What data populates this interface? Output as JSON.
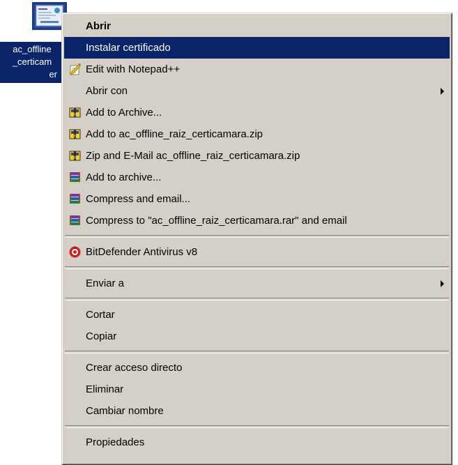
{
  "desktop_file": {
    "label_lines": [
      "ac_offline",
      "_certicam",
      "er"
    ],
    "icon": "certificate-icon"
  },
  "menu": {
    "items": [
      {
        "label": "Abrir",
        "icon": null
      },
      {
        "label": "Instalar certificado",
        "icon": null
      },
      {
        "label": "Edit with Notepad++",
        "icon": "notepad-plus-plus-icon"
      },
      {
        "label": "Abrir con",
        "icon": null
      },
      {
        "label": "Add to Archive...",
        "icon": "winzip-icon"
      },
      {
        "label": "Add to ac_offline_raiz_certicamara.zip",
        "icon": "winzip-icon"
      },
      {
        "label": "Zip and E-Mail ac_offline_raiz_certicamara.zip",
        "icon": "winzip-icon"
      },
      {
        "label": "Add to archive...",
        "icon": "winrar-icon"
      },
      {
        "label": "Compress and email...",
        "icon": "winrar-icon"
      },
      {
        "label": "Compress to \"ac_offline_raiz_certicamara.rar\" and email",
        "icon": "winrar-icon"
      },
      {
        "label": "BitDefender Antivirus v8",
        "icon": "bitdefender-icon"
      },
      {
        "label": "Enviar a",
        "icon": null
      },
      {
        "label": "Cortar",
        "icon": null
      },
      {
        "label": "Copiar",
        "icon": null
      },
      {
        "label": "Crear acceso directo",
        "icon": null
      },
      {
        "label": "Eliminar",
        "icon": null
      },
      {
        "label": "Cambiar nombre",
        "icon": null
      },
      {
        "label": "Propiedades",
        "icon": null
      }
    ]
  },
  "colors": {
    "menu_background": "#d4d0c8",
    "highlight": "#0a246a",
    "highlight_text": "#ffffff"
  }
}
